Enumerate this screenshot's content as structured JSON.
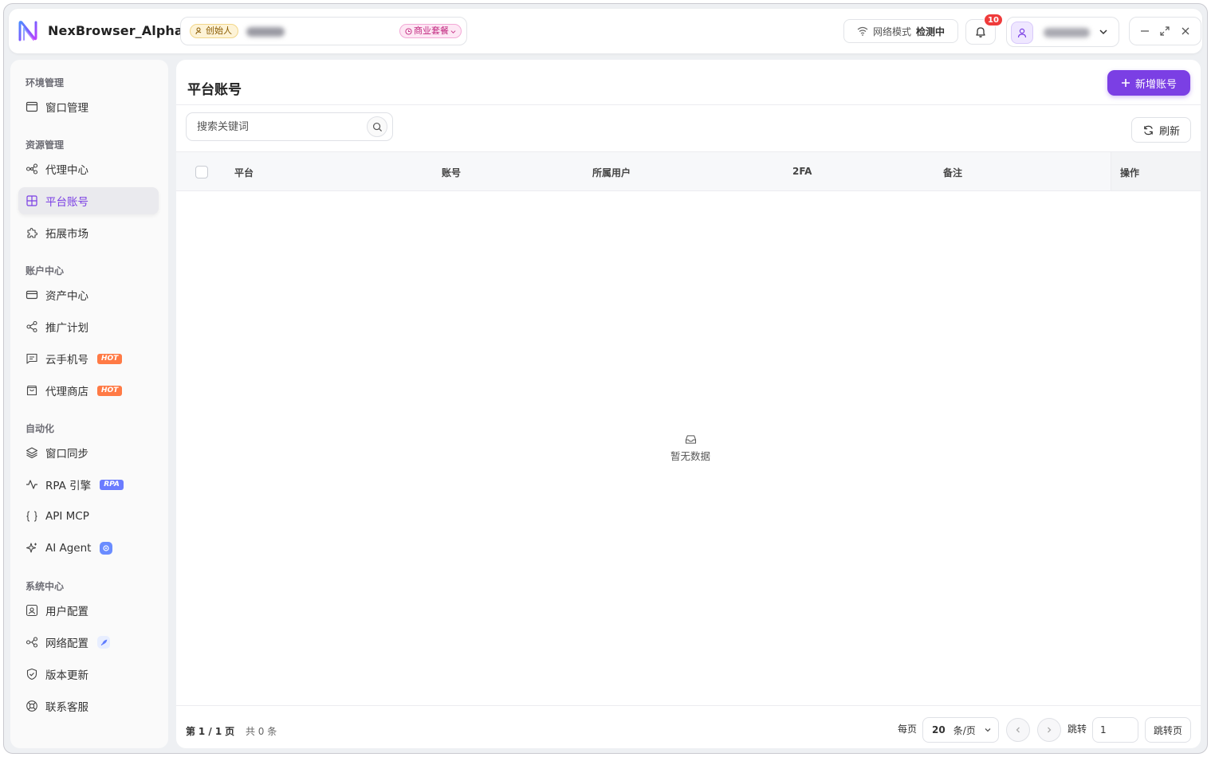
{
  "app": {
    "title": "NexBrowser_Alpha",
    "founder_badge": "创始人",
    "plan_badge": "商业套餐",
    "network_label": "网络模式",
    "network_status": "检测中",
    "notification_count": "10",
    "accent_color": "#7b3fe4"
  },
  "sidebar": {
    "sections": [
      {
        "title": "环境管理",
        "items": [
          {
            "label": "窗口管理",
            "icon": "window-icon"
          }
        ]
      },
      {
        "title": "资源管理",
        "items": [
          {
            "label": "代理中心",
            "icon": "proxy-icon"
          },
          {
            "label": "平台账号",
            "icon": "grid-icon",
            "active": true
          },
          {
            "label": "拓展市场",
            "icon": "puzzle-icon"
          }
        ]
      },
      {
        "title": "账户中心",
        "items": [
          {
            "label": "资产中心",
            "icon": "card-icon"
          },
          {
            "label": "推广计划",
            "icon": "share-icon"
          },
          {
            "label": "云手机号",
            "icon": "message-icon",
            "tag": "HOT"
          },
          {
            "label": "代理商店",
            "icon": "store-icon",
            "tag": "HOT"
          }
        ]
      },
      {
        "title": "自动化",
        "items": [
          {
            "label": "窗口同步",
            "icon": "layers-icon"
          },
          {
            "label": "RPA 引擎",
            "icon": "activity-icon",
            "tag": "RPA"
          },
          {
            "label": "API MCP",
            "icon": "braces-icon"
          },
          {
            "label": "AI Agent",
            "icon": "sparkles-icon"
          }
        ]
      },
      {
        "title": "系统中心",
        "items": [
          {
            "label": "用户配置",
            "icon": "user-settings-icon"
          },
          {
            "label": "网络配置",
            "icon": "network-icon"
          },
          {
            "label": "版本更新",
            "icon": "shield-check-icon"
          },
          {
            "label": "联系客服",
            "icon": "lifebuoy-icon"
          }
        ]
      }
    ]
  },
  "main": {
    "page_title": "平台账号",
    "add_button": "新增账号",
    "search_placeholder": "搜索关键词",
    "refresh_button": "刷新",
    "columns": [
      "平台",
      "账号",
      "所属用户",
      "2FA",
      "备注",
      "操作"
    ],
    "empty_text": "暂无数据"
  },
  "pagination": {
    "page_prefix": "第",
    "page_current": "1 / 1",
    "page_suffix": "页",
    "total": "共 0 条",
    "per_page_label": "每页",
    "per_page_value": "20",
    "per_page_unit": "条/页",
    "jump_label": "跳转",
    "jump_value": "1",
    "jump_button": "跳转页"
  }
}
